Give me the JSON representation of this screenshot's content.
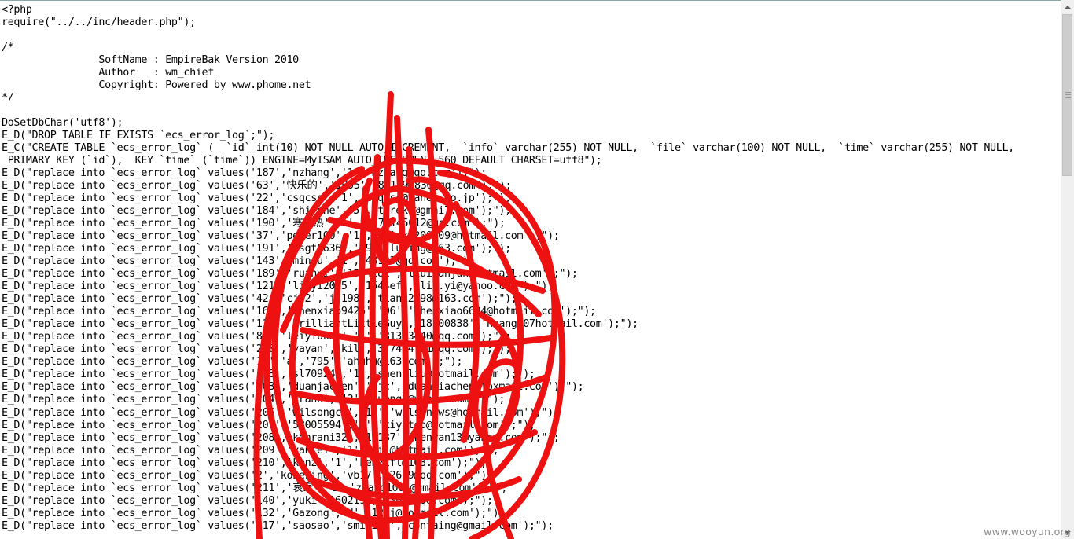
{
  "code_lines": [
    "<?php",
    "require(\"../../inc/header.php\");",
    "",
    "/*",
    "                SoftName : EmpireBak Version 2010",
    "                Author   : wm_chief",
    "                Copyright: Powered by www.phome.net",
    "*/",
    "",
    "DoSetDbChar('utf8');",
    "E_D(\"DROP TABLE IF EXISTS `ecs_error_log`;\");",
    "E_C(\"CREATE TABLE `ecs_error_log` (  `id` int(10) NOT NULL AUTO_INCREMENT,  `info` varchar(255) NOT NULL,  `file` varchar(100) NOT NULL,  `time` varchar(255) NOT NULL,",
    " PRIMARY KEY (`id`),  KEY `time` (`time`)) ENGINE=MyISAM AUTO_INCREMENT=560 DEFAULT CHARSET=utf8\");",
    "E_D(\"replace into `ecs_error_log` values('187','nzhang','1','nzhang@qq.com');\");",
    "E_D(\"replace into `ecs_error_log` values('63','快乐的','1995','821290836@qq.com');\");",
    "E_D(\"replace into `ecs_error_log` values('22','csqcss','1','csqcss@yahoo.co.jp');\");",
    "E_D(\"replace into `ecs_error_log` values('184','shirone','5','tyrekt@gmail.com');\");",
    "E_D(\"replace into `ecs_error_log` values('190','寒地热','1','1372145012@qq.com');\");",
    "E_D(\"replace into `ecs_error_log` values('37','peter100','1','whisky200909@hotmail.com');\");",
    "E_D(\"replace into `ecs_error_log` values('191','ksgt0636','79','lujing@163.com');\");",
    "E_D(\"replace into `ecs_error_log` values('143','minsu','1','48123@qq.com');\");",
    "E_D(\"replace into `ecs_error_log` values('189','ruanyi','1544182','liuiyanjun@hotmail.com');\");",
    "E_D(\"replace into `ecs_error_log` values('121','liuyi2015','1544ef','liu.yi@yahoo.com');\");",
    "E_D(\"replace into `ecs_error_log` values('42','cj52','jj198','tian12198@163.com');\");",
    "E_D(\"replace into `ecs_error_log` values('166','chenxiao9426','06','chenxiao6604@hotmail.com');\");",
    "E_D(\"replace into `ecs_error_log` values('117','BrilliantLittleGuy','18100838','huang@07hotmail.com');\");",
    "E_D(\"replace into `ecs_error_log` values('81','leiyiukai','1','81323440@qq.com');\");",
    "E_D(\"replace into `ecs_error_log` values('200','yayan','kil','377474721@qq.com');\");",
    "E_D(\"replace into `ecs_error_log` values('19','a','795','ahuhu@163.com');\");",
    "E_D(\"replace into `ecs_error_log` values('178','sl70924','1','shen-liu@hotmail.com');\");",
    "E_D(\"replace into `ecs_error_log` values('203','duanjachen','djc','duanjiachen@foxmail.com');\");",
    "E_D(\"replace into `ecs_error_log` values('204','frank','12','hueng2@yahoo.com');\");",
    "E_D(\"replace into `ecs_error_log` values('205','wilsongcs','12','wilson.ws@hotmail.com');\");",
    "E_D(\"replace into `ecs_error_log` values('207','58005594','1','kiyotoo@hotmail.com');\");",
    "E_D(\"replace into `ecs_error_log` values('208','kenrani32','11187','kenran13@yahoo.com');\");",
    "E_D(\"replace into `ecs_error_log` values('209','yanlei','1','oil@hotmail.com');\");",
    "E_D(\"replace into `ecs_error_log` values('210','kenz','1','kenzifl@163.com');\");",
    "E_D(\"replace into `ecs_error_log` values('2','kobeking','vb17','2619@qq.com');\");",
    "E_D(\"replace into `ecs_error_log` values('211','哀家','1','zhang1001@gmail.com');\");",
    "E_D(\"replace into `ecs_error_log` values('140','yuki','60219','93024@qq.com');\");",
    "E_D(\"replace into `ecs_error_log` values('132','Gazong','d','12yj@hotmail.com');\");",
    "E_D(\"replace into `ecs_error_log` values('217','saosao','smiling','containg@gmail.com');\");"
  ],
  "watermark": "www.wooyun.org",
  "colors": {
    "text": "#000000",
    "background": "#ffffff",
    "scribble": "#ee1111",
    "scrollbar_track": "#f0f0f0",
    "scrollbar_thumb": "#cdcdcd",
    "watermark": "#8c8c8c"
  },
  "icons": {
    "scroll_up": "triangle-up-icon",
    "scroll_down": "triangle-down-icon",
    "thumb_grip": "grip-lines-icon"
  },
  "scrollbar": {
    "thumb_fraction": 0.3,
    "scroll_position": 0.0
  }
}
